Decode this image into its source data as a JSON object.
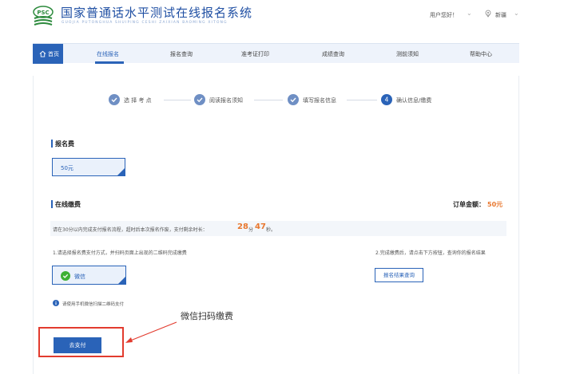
{
  "header": {
    "logo_text": "PSC",
    "title": "国家普通话水平测试在线报名系统",
    "subtitle": "GUOJIA PUTONGHUA SHUIPING CESHI ZAIXIAN BAOMING XITONG",
    "greeting": "用户您好！",
    "location": "新疆"
  },
  "nav": {
    "home": "首页",
    "items": [
      {
        "label": "在线报名",
        "active": true
      },
      {
        "label": "报名查询",
        "active": false
      },
      {
        "label": "准考证打印",
        "active": false
      },
      {
        "label": "成绩查询",
        "active": false
      },
      {
        "label": "测前须知",
        "active": false
      },
      {
        "label": "帮助中心",
        "active": false
      }
    ]
  },
  "steps": [
    {
      "label": "选 择 考 点",
      "done": true
    },
    {
      "label": "阅读报名须知",
      "done": true
    },
    {
      "label": "填写报名信息",
      "done": true
    },
    {
      "label": "确认信息/缴费",
      "number": "4",
      "done": false
    }
  ],
  "fee_section": {
    "title": "报名费",
    "amount": "50元"
  },
  "payment_section": {
    "title": "在线缴费",
    "order_label": "订单金额：",
    "order_value": "50元",
    "notice_text": "请在30分以内完成支付报名流程，超时后本次报名作废，支付剩余时长：",
    "minutes": "28",
    "minutes_unit": "分",
    "seconds": "47",
    "seconds_unit": "秒。",
    "instruction_left": "1.请选择报名费支付方式，并扫码页面上出现的二维码完成缴费",
    "instruction_right": "2.完成缴费后，请点击下方按钮，查询你的报名结果",
    "wechat_label": "微信",
    "query_button": "报名结果查询",
    "tip": "请使用手机微信扫描二维码支付",
    "pay_button": "去支付"
  },
  "annotation": {
    "text": "微信扫码缴费"
  },
  "colors": {
    "primary": "#2a63b8",
    "accent": "#e8772e",
    "annotation": "#e23b2e",
    "wechat": "#3cb034"
  }
}
